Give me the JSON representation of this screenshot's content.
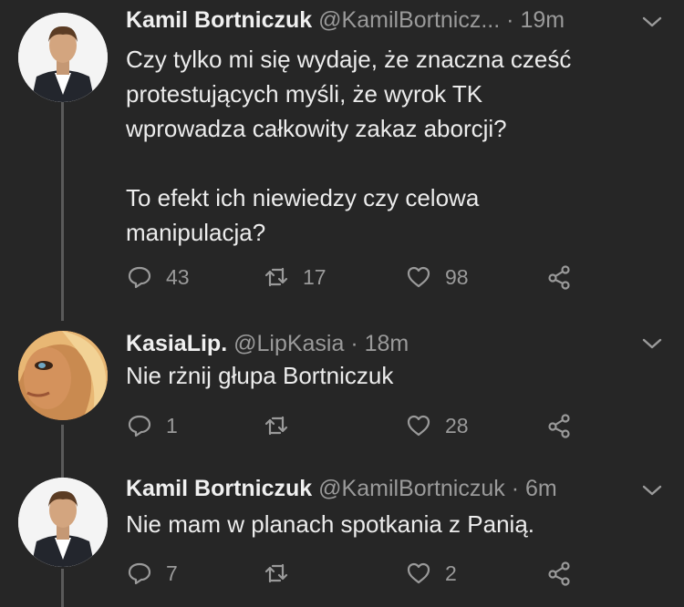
{
  "tweets": [
    {
      "name": "Kamil Bortniczuk",
      "handle": "@KamilBortnicz...",
      "time": "19m",
      "lines": [
        "Czy tylko mi się wydaje, że znaczna cześć",
        "protestujących myśli, że wyrok TK",
        "wprowadza całkowity zakaz aborcji?"
      ],
      "lines2": [
        "To efekt ich niewiedzy czy celowa",
        "manipulacja?"
      ],
      "replies": "43",
      "retweets": "17",
      "likes": "98"
    },
    {
      "name": "KasiaLip.",
      "handle": "@LipKasia",
      "time": "18m",
      "lines": [
        "Nie rżnij głupa Bortniczuk"
      ],
      "replies": "1",
      "retweets": "",
      "likes": "28"
    },
    {
      "name": "Kamil Bortniczuk",
      "handle": "@KamilBortniczuk",
      "time": "6m",
      "lines": [
        "Nie mam w planach spotkania z Panią."
      ],
      "replies": "7",
      "retweets": "",
      "likes": "2"
    }
  ],
  "colors": {
    "background": "#262626",
    "muted": "#9a9a9a",
    "text": "#ececec",
    "thread_line": "#5a5a5a"
  },
  "icons": [
    "reply-icon",
    "retweet-icon",
    "like-icon",
    "share-icon",
    "chevron-down-icon"
  ]
}
